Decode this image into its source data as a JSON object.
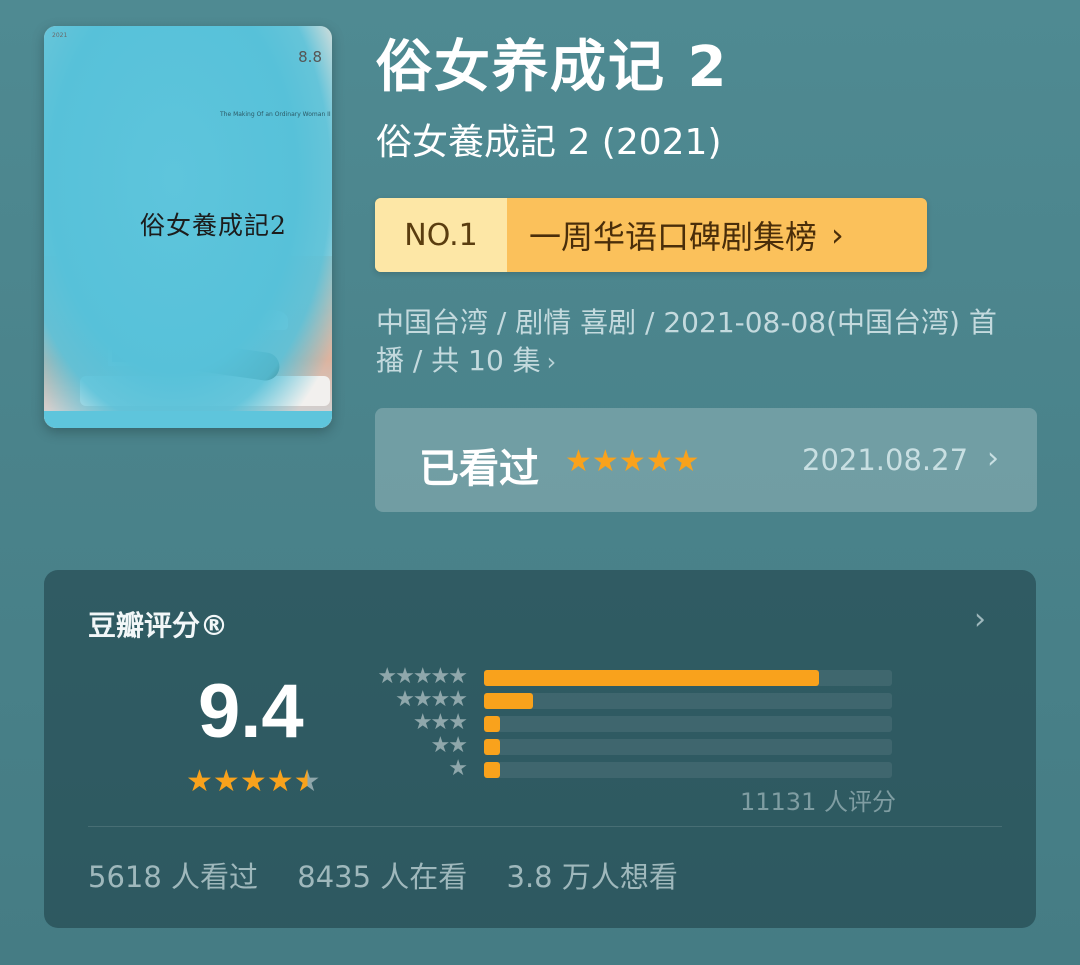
{
  "poster": {
    "date_big": "8.8",
    "en_subtitle": "The Making Of an Ordinary Woman II",
    "logo_text": "俗女養成記2",
    "top_text": "2021"
  },
  "title": {
    "main": "俗女养成记 2",
    "original": "俗女養成記 2 (2021)"
  },
  "rank": {
    "no": "NO.1",
    "label": "一周华语口碑剧集榜"
  },
  "meta": {
    "text": "中国台湾 / 剧情 喜剧 / 2021-08-08(中国台湾) 首播 / 共 10 集"
  },
  "watched": {
    "label": "已看过",
    "user_rating": 5,
    "date": "2021.08.27"
  },
  "rating": {
    "title": "豆瓣评分®",
    "score": "9.4",
    "stars": 4.5,
    "count_text": "11131 人评分",
    "distribution": [
      {
        "stars": 5,
        "fraction": 0.82
      },
      {
        "stars": 4,
        "fraction": 0.12
      },
      {
        "stars": 3,
        "fraction": 0.03
      },
      {
        "stars": 2,
        "fraction": 0.03
      },
      {
        "stars": 1,
        "fraction": 0.03
      }
    ],
    "stats": {
      "seen": "5618 人看过",
      "watching": "8435 人在看",
      "want": "3.8 万人想看"
    }
  },
  "colors": {
    "accent": "#f9a21c",
    "badge": "#fbc15b",
    "background": "#4f8a92"
  }
}
